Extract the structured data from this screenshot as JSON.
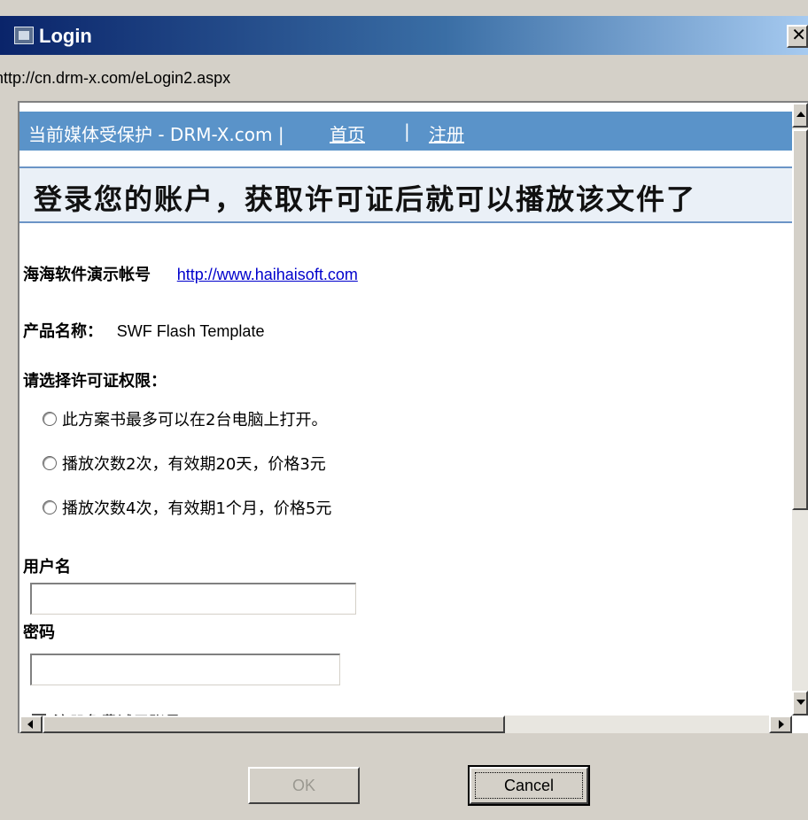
{
  "window": {
    "title": "Login",
    "url": "http://cn.drm-x.com/eLogin2.aspx"
  },
  "page": {
    "topbar": {
      "brand": "当前媒体受保护 - DRM-X.com |",
      "home": "首页",
      "separator": "|",
      "register": "注册"
    },
    "headline": "登录您的账户，获取许可证后就可以播放该文件了",
    "account_label": "海海软件演示帐号",
    "account_link": "http://www.haihaisoft.com",
    "product_label": "产品名称：",
    "product_name": "SWF Flash Template",
    "license_prompt": "请选择许可证权限：",
    "license_options": [
      "此方案书最多可以在2台电脑上打开。",
      "播放次数2次，有效期20天，价格3元",
      "播放次数4次，有效期1个月，价格5元"
    ],
    "username_label": "用户名",
    "username_value": "",
    "password_label": "密码",
    "password_value": "",
    "trial_checkbox_label": "注册免费试用账号"
  },
  "buttons": {
    "ok": "OK",
    "cancel": "Cancel"
  }
}
